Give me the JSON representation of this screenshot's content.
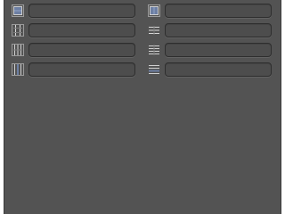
{
  "panel": {
    "background": "#535353",
    "fields": [
      {
        "column": "left",
        "icon": "frame-border-icon",
        "value": ""
      },
      {
        "column": "left",
        "icon": "column-dividers-icon",
        "value": ""
      },
      {
        "column": "left",
        "icon": "column-grid-icon",
        "value": ""
      },
      {
        "column": "left",
        "icon": "column-guides-icon",
        "value": ""
      },
      {
        "column": "right",
        "icon": "frame-border-alt-icon",
        "value": ""
      },
      {
        "column": "right",
        "icon": "row-dividers-icon",
        "value": ""
      },
      {
        "column": "right",
        "icon": "row-grid-icon",
        "value": ""
      },
      {
        "column": "right",
        "icon": "row-guides-icon",
        "value": ""
      }
    ]
  }
}
